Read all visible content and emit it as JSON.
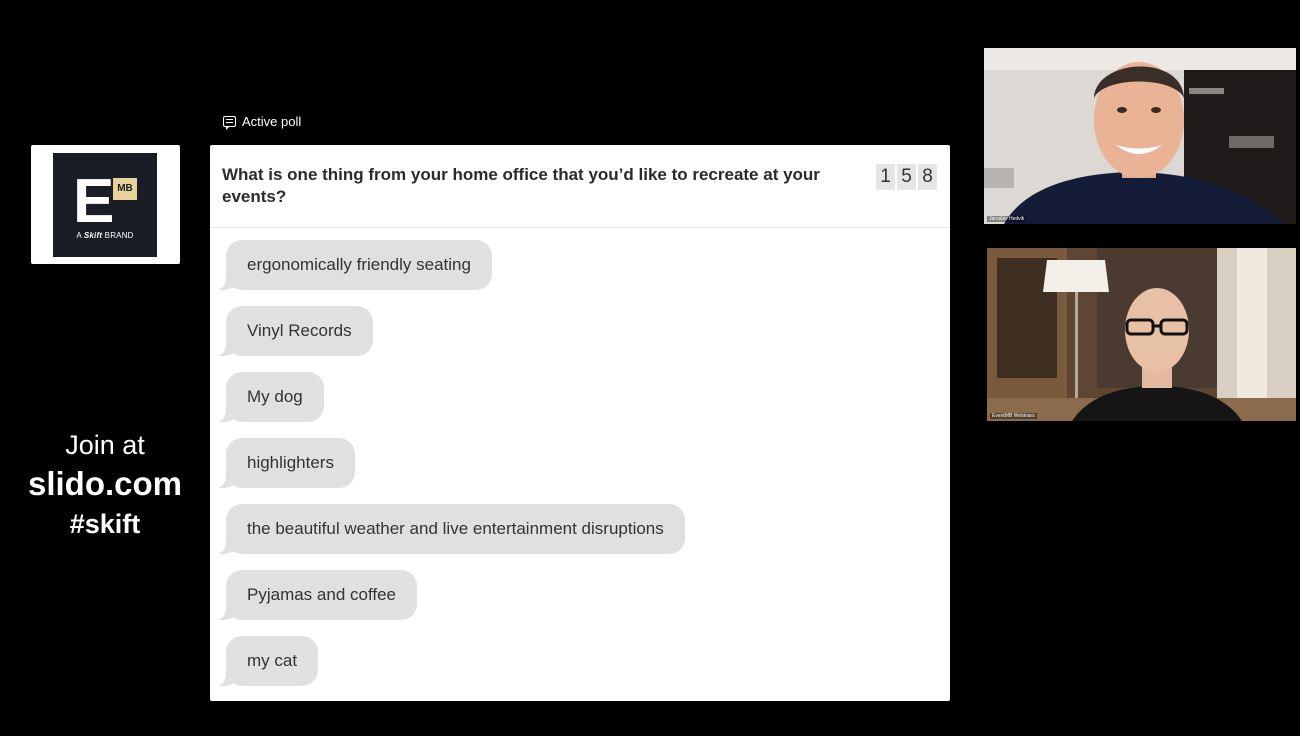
{
  "logo": {
    "letter": "E",
    "badge": "MB",
    "tagline_prefix": "A",
    "tagline_brand": "Skift",
    "tagline_suffix": "BRAND"
  },
  "join": {
    "line1": "Join at",
    "line2": "slido.com",
    "line3": "#skift"
  },
  "poll": {
    "label": "Active poll",
    "question": "What is one thing from your home office that you’d like to recreate at your events?",
    "count_digits": [
      "1",
      "5",
      "8"
    ],
    "responses": [
      "ergonomically friendly seating",
      "Vinyl Records",
      "My dog",
      "highlighters",
      "the beautiful weather and live entertainment disruptions",
      "Pyjamas and coffee",
      "my cat"
    ]
  },
  "videos": {
    "participant1_name": "Jaroslav Hedvik",
    "participant2_name": "EventMB Webinars"
  },
  "colors": {
    "background": "#000000",
    "card": "#ffffff",
    "bubble": "#e0e0e0",
    "logo_dark": "#1a1d26",
    "logo_badge": "#e8d29a"
  }
}
